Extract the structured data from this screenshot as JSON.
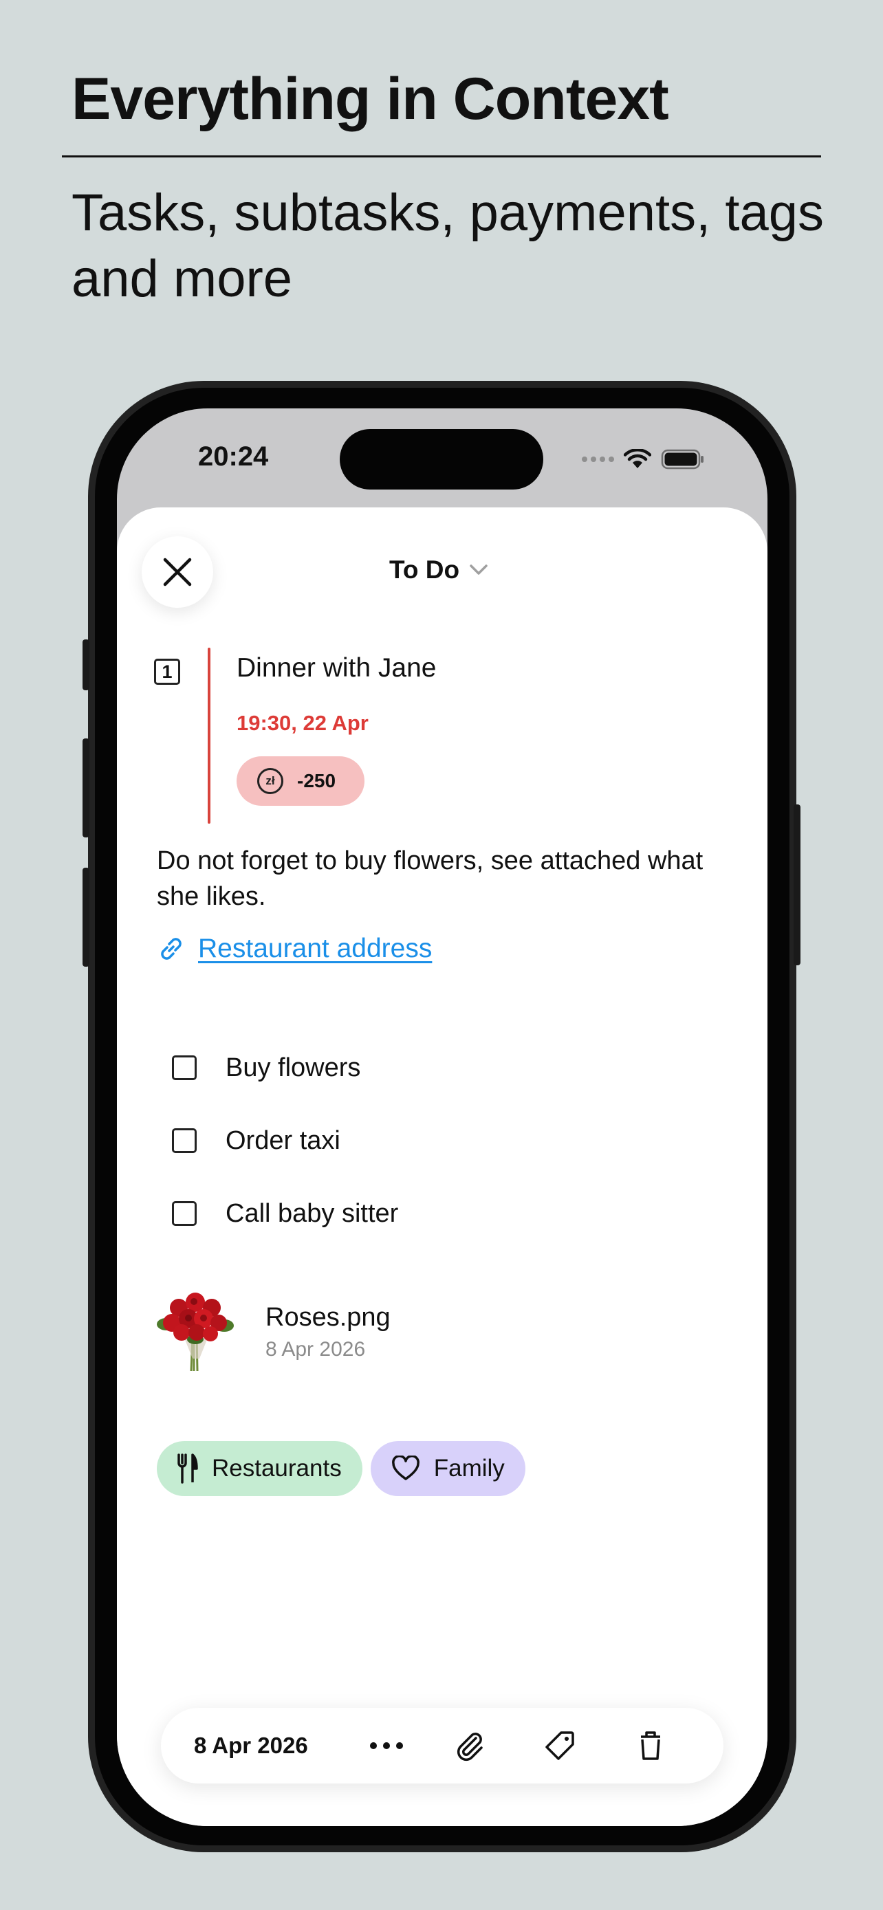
{
  "marketing": {
    "headline": "Everything in Context",
    "subhead": "Tasks, subtasks, payments, tags and more"
  },
  "status_bar": {
    "time": "20:24"
  },
  "header": {
    "list_name": "To Do"
  },
  "task": {
    "priority_number": "1",
    "title": "Dinner with Jane",
    "due": "19:30, 22 Apr",
    "payment": {
      "currency_symbol": "zł",
      "amount": "-250"
    },
    "note": "Do not forget to buy flowers, see attached what she likes.",
    "link_label": "Restaurant address",
    "subtasks": [
      {
        "label": "Buy flowers",
        "checked": false
      },
      {
        "label": "Order taxi",
        "checked": false
      },
      {
        "label": "Call baby sitter",
        "checked": false
      }
    ],
    "attachment": {
      "name": "Roses.png",
      "date": "8 Apr 2026"
    },
    "tags": [
      {
        "label": "Restaurants",
        "icon": "fork-knife-icon",
        "color": "#c5ecd2"
      },
      {
        "label": "Family",
        "icon": "heart-icon",
        "color": "#d8d1fa"
      }
    ]
  },
  "toolbar": {
    "date": "8 Apr 2026",
    "icons": [
      "more-icon",
      "paperclip-icon",
      "tag-icon",
      "trash-icon"
    ]
  },
  "colors": {
    "background": "#d3dbdb",
    "priority": "#d8433c",
    "due_text": "#dd3b37",
    "payment_pill": "#f6c0c0",
    "link": "#1a8fe8"
  }
}
